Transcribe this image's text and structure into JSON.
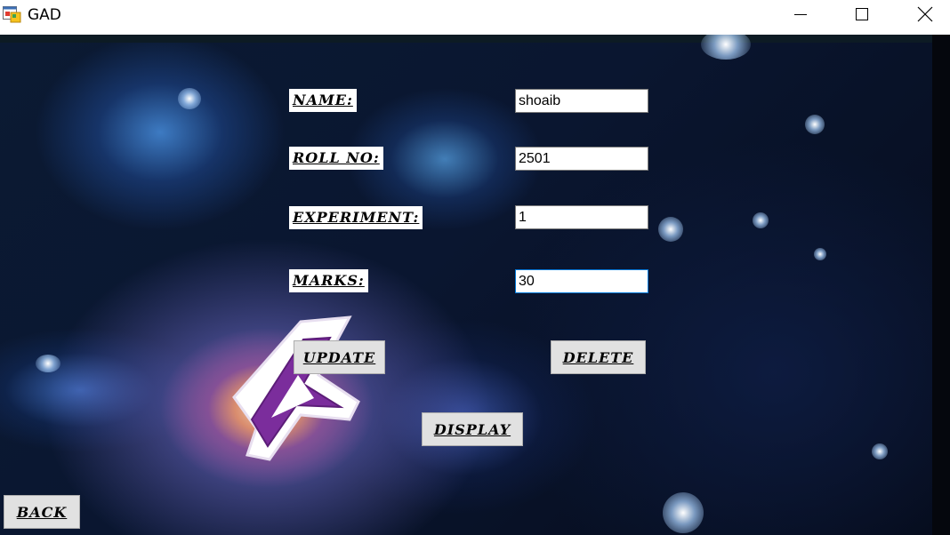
{
  "window": {
    "title": "GAD",
    "icon": "app-form-icon",
    "controls": [
      "minimize-icon",
      "maximize-icon",
      "close-icon"
    ]
  },
  "form": {
    "name_label": "NAME:",
    "name_value": "shoaib",
    "rollno_label": "ROLL NO:",
    "rollno_value": "2501",
    "experiment_label": "EXPERIMENT:",
    "experiment_value": "1",
    "marks_label": "MARKS:",
    "marks_value": "30"
  },
  "buttons": {
    "update": "UPDATE",
    "delete": "DELETE",
    "display": "DISPLAY",
    "back": "BACK"
  },
  "colors": {
    "logo_purple": "#7b2d9c",
    "button_face": "#e1e1e1",
    "focus_border": "#0078d7"
  }
}
